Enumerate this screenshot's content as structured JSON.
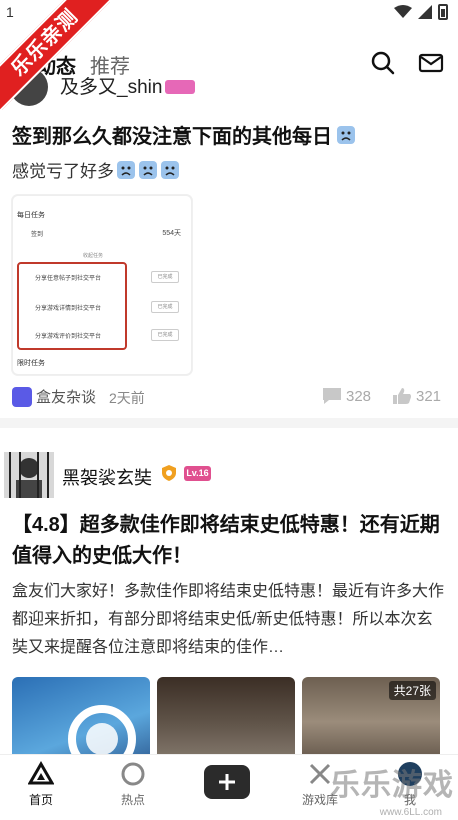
{
  "status_bar": {
    "time": "1"
  },
  "ribbon": {
    "text": "乐乐亲测"
  },
  "top_nav": {
    "active_tab": "动态",
    "recommend_tab": "推荐"
  },
  "post1": {
    "username": "及多又_shin",
    "title": "签到那么久都没注意下面的其他每日",
    "body": "感觉亏了好多",
    "screenshot": {
      "section_daily": "每日任务",
      "signin": "签到",
      "days": "554天",
      "more": "收起任务",
      "task1": "分享任意帖子到社交平台",
      "task2": "分享游戏详情到社交平台",
      "task3": "分享游戏评价到社交平台",
      "done": "已完成",
      "section_limited": "限时任务"
    },
    "tag": "盒友杂谈",
    "time_ago": "2天前",
    "comments": "328",
    "likes": "321"
  },
  "post2": {
    "username": "黑袈裟玄奘",
    "level": "Lv.16",
    "title": "【4.8】超多款佳作即将结束史低特惠！还有近期值得入的史低大作！",
    "body": "盒友们大家好！多款佳作即将结束史低特惠！最近有许多大作都迎来折扣，有部分即将结束史低/新史低特惠！所以本次玄奘又来提醒各位注意即将结束的佳作…",
    "image_count": "共27张"
  },
  "bottom_nav": {
    "home": "首页",
    "hot": "热点",
    "games": "游戏库",
    "me": "我"
  },
  "watermark": {
    "brand": "乐乐游戏",
    "site": "www.6LL.com"
  },
  "colors": {
    "ribbon": "#e02020",
    "level_badge": "#e0508f",
    "tag_icon": "#5a5ae6"
  }
}
